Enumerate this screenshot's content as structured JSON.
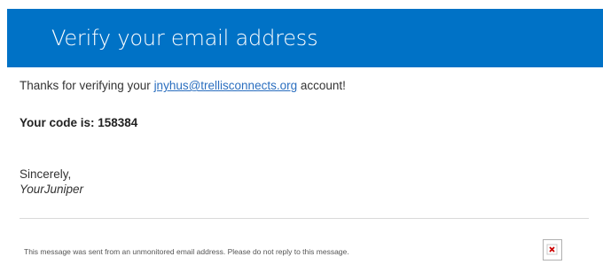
{
  "header": {
    "title": "Verify your email address",
    "background_color": "#0072c6"
  },
  "message": {
    "thanks_prefix": "Thanks for verifying your ",
    "email_address": "jnyhus@trellisconnects.org",
    "thanks_suffix": " account!",
    "code_line": "Your code is: 158384",
    "closing": "Sincerely,",
    "signature": "YourJuniper"
  },
  "footer": {
    "note": "This message was sent from an unmonitored email address. Please do not reply to this message.",
    "image_icon": "broken-image-icon"
  },
  "colors": {
    "link": "#2a6ebf",
    "broken_image_x": "#cc0000"
  }
}
